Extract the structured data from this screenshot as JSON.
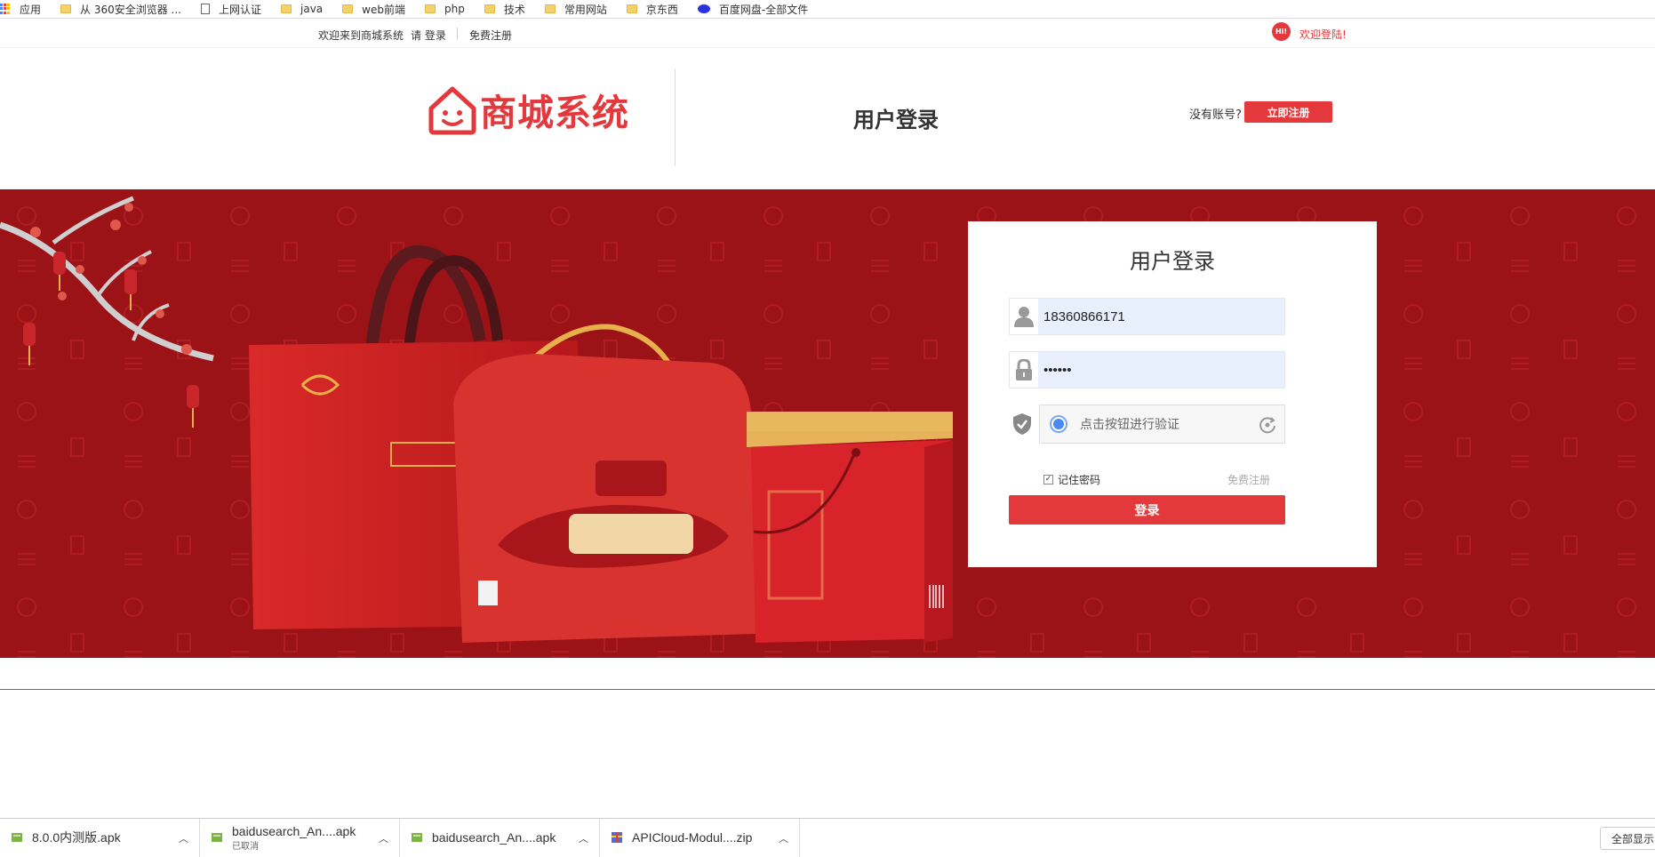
{
  "bookmarks": [
    {
      "label": "应用",
      "icon": "apps-icon"
    },
    {
      "label": "从 360安全浏览器 ...",
      "icon": "folder-icon"
    },
    {
      "label": "上网认证",
      "icon": "page-icon"
    },
    {
      "label": "java",
      "icon": "folder-icon"
    },
    {
      "label": "web前端",
      "icon": "folder-icon"
    },
    {
      "label": "php",
      "icon": "folder-icon"
    },
    {
      "label": "技术",
      "icon": "folder-icon"
    },
    {
      "label": "常用网站",
      "icon": "folder-icon"
    },
    {
      "label": "京东西",
      "icon": "folder-icon"
    },
    {
      "label": "百度网盘-全部文件",
      "icon": "baidu-icon"
    }
  ],
  "topbar": {
    "welcome": "欢迎来到商城系统",
    "login": "请 登录",
    "register": "免费注册",
    "hi_badge": "Hi!",
    "hi_text": "欢迎登陆!"
  },
  "header": {
    "logo_text": "商城系统",
    "page_title": "用户登录",
    "no_account": "没有账号?",
    "register_button": "立即注册"
  },
  "login": {
    "title": "用户登录",
    "username": "18360866171",
    "password": "••••••",
    "captcha_text": "点击按钮进行验证",
    "remember": "记住密码",
    "remember_checked": true,
    "free_register": "免费注册",
    "submit": "登录"
  },
  "downloads": [
    {
      "name": "8.0.0内测版.apk",
      "status": ""
    },
    {
      "name": "baidusearch_An....apk",
      "status": "已取消"
    },
    {
      "name": "baidusearch_An....apk",
      "status": ""
    },
    {
      "name": "APICloud-Modul....zip",
      "status": ""
    }
  ],
  "show_all": "全部显示",
  "colors": {
    "brand": "#e4393c",
    "banner": "#9b1217"
  }
}
